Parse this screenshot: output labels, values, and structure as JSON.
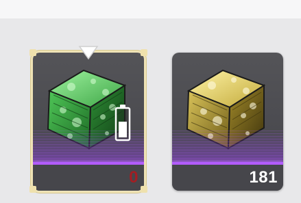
{
  "items": [
    {
      "name": "green-cube",
      "count": "0",
      "selected": true,
      "count_color": "#a21e23",
      "gem_color": "#3fae47"
    },
    {
      "name": "yellow-cube",
      "count": "181",
      "selected": false,
      "count_color": "#ffffff",
      "gem_color": "#c8b338"
    }
  ],
  "colors": {
    "selection_frame": "#efe3b6",
    "purple_glow": "#b35cff",
    "card_bg": "#4b4b50"
  },
  "icons": {
    "selection_marker": "triangle-down-icon",
    "battery": "battery-icon"
  }
}
